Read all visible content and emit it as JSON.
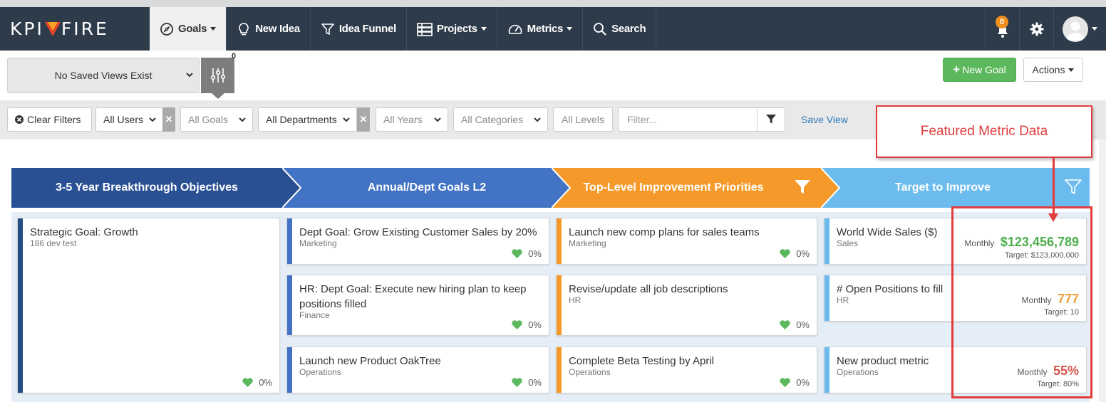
{
  "navbar": {
    "logo_left": "KPI",
    "logo_right": "FIRE",
    "items": [
      {
        "label": "Goals",
        "icon": "compass-icon",
        "has_caret": true,
        "active": true
      },
      {
        "label": "New Idea",
        "icon": "lightbulb-icon",
        "has_caret": false
      },
      {
        "label": "Idea Funnel",
        "icon": "funnel-icon",
        "has_caret": false
      },
      {
        "label": "Projects",
        "icon": "projects-icon",
        "has_caret": true
      },
      {
        "label": "Metrics",
        "icon": "gauge-icon",
        "has_caret": true
      },
      {
        "label": "Search",
        "icon": "search-icon",
        "has_caret": false
      }
    ],
    "notification_count": "0"
  },
  "toolbar": {
    "saved_views": "No Saved Views Exist",
    "view_settings_count": "0",
    "new_goal_label": "New Goal",
    "actions_label": "Actions"
  },
  "filters": {
    "clear_filters": "Clear Filters",
    "users": "All Users",
    "goals": "All Goals",
    "departments": "All Departments",
    "years": "All Years",
    "categories": "All Categories",
    "levels": "All Levels",
    "filter_placeholder": "Filter...",
    "save_view": "Save View"
  },
  "columns": [
    {
      "title": "3-5 Year Breakthrough Objectives",
      "color": "#2a5094"
    },
    {
      "title": "Annual/Dept Goals L2",
      "color": "#4373c4"
    },
    {
      "title": "Top-Level Improvement Priorities",
      "color": "#f59a2a"
    },
    {
      "title": "Target to Improve",
      "color": "#6cbbef"
    }
  ],
  "cards": {
    "col1": [
      {
        "title": "Strategic Goal: Growth",
        "sub": "186 dev test",
        "health": "0%"
      }
    ],
    "col2": [
      {
        "title": "Dept Goal: Grow Existing Customer Sales by 20%",
        "sub": "Marketing",
        "health": "0%"
      },
      {
        "title": "HR: Dept Goal: Execute new hiring plan to keep positions filled",
        "sub": "Finance",
        "health": "0%"
      },
      {
        "title": "Launch new Product OakTree",
        "sub": "Operations",
        "health": "0%"
      }
    ],
    "col3": [
      {
        "title": "Launch new comp plans for sales teams",
        "sub": "Marketing",
        "health": "0%"
      },
      {
        "title": "Revise/update all job descriptions",
        "sub": "HR",
        "health": "0%"
      },
      {
        "title": "Complete Beta Testing by April",
        "sub": "Operations",
        "health": "0%"
      }
    ],
    "col4": [
      {
        "title": "World Wide Sales ($)",
        "sub": "Sales",
        "freq": "Monthly",
        "value": "$123,456,789",
        "value_color": "#4cae4c",
        "target": "Target: $123,000,000"
      },
      {
        "title": "# Open Positions to fill",
        "sub": "HR",
        "freq": "Monthly",
        "value": "777",
        "value_color": "#f0a03c",
        "target": "Target: 10"
      },
      {
        "title": "New product metric",
        "sub": "Operations",
        "freq": "Monthly",
        "value": "55%",
        "value_color": "#d9534f",
        "target": "Target: 80%"
      }
    ]
  },
  "annotation": {
    "callout": "Featured Metric Data"
  }
}
